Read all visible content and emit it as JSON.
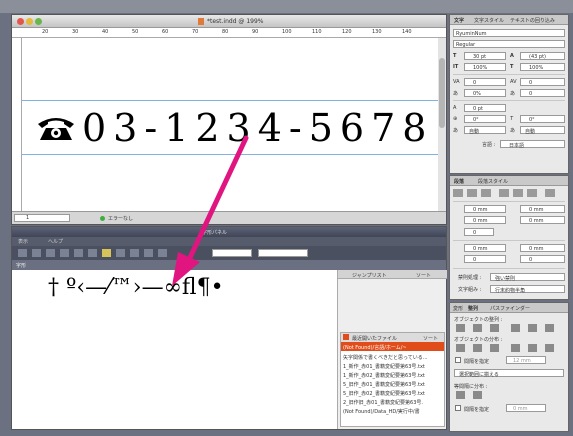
{
  "doc_window": {
    "title": "*test.indd @ 199%",
    "ruler_marks": [
      "20",
      "30",
      "40",
      "50",
      "60",
      "70",
      "80",
      "90",
      "100",
      "110",
      "120",
      "130",
      "140"
    ],
    "phone_number": "03-1234-5678",
    "status_page": "1",
    "status_text": "エラーなし"
  },
  "glyph_window": {
    "title": "字形パネル",
    "tab_label": "字形",
    "menu_items": [
      "表示",
      "ヘルプ"
    ],
    "glyph_row": "† º‹—⁄™›—∞ﬂ¶•",
    "panel_tabs": [
      "ジャンプリスト",
      "ソート"
    ],
    "recent_title": "最近開いたファイル",
    "recent_tab": "ソート",
    "recent_items": [
      "(Not Found)/言語/ホーム/~",
      "矢字関係で書くべきだと思っている...",
      "1_新作_赤01_書籍変紀要第63号.txt",
      "1_新作_赤02_書籍変紀要第63号.txt",
      "5_旧作_赤01_書籍変紀要第63号.txt",
      "5_旧作_赤02_書籍変紀要第63号.txt",
      "2_旧作旧_赤01_書籍変紀要第63号.",
      "(Not Found)/Data_HD/実行中/書"
    ]
  },
  "char_panel": {
    "tabs": [
      "文字",
      "文字スタイル",
      "テキストの回り込み"
    ],
    "font_family": "RyuminNum",
    "font_style": "Regular",
    "size": "30 pt",
    "leading": "(43 pt)",
    "vscale": "100%",
    "hscale": "100%",
    "kerning": "0",
    "tracking": "0",
    "tsume": "0%",
    "aki": "0",
    "baseline": "0 pt",
    "rotate": "0°",
    "skew": "0°",
    "auto_left": "自動",
    "auto_right": "自動",
    "language_label": "言語 :",
    "language": "日本語"
  },
  "para_panel": {
    "tabs": [
      "段落",
      "段落スタイル"
    ],
    "indent_left": "0 mm",
    "indent_right": "0 mm",
    "first_line": "0 mm",
    "last_line": "0 mm",
    "space_before": "0 mm",
    "space_after": "0 mm",
    "drop_lines": "0",
    "drop_chars": "0",
    "kinsoku_label": "禁則処理 :",
    "kinsoku_value": "強い禁則",
    "mojikumi_label": "文字組み :",
    "mojikumi_value": "行末約物半角",
    "hyph_value": "0"
  },
  "align_panel": {
    "tabs": [
      "変形",
      "整列",
      "パスファインダー"
    ],
    "section1": "オブジェクトの整列 :",
    "section2": "オブジェクトの分布 :",
    "spacing_label": "間隔を指定",
    "spacing_value": "12 mm",
    "align_to": "選択範囲に揃える",
    "section3": "等間隔に分布 :",
    "spacing_label2": "間隔を指定",
    "spacing_value2": "0 mm"
  },
  "colors": {
    "arrow": "#e0157f",
    "highlight": "#e04d1a",
    "selection": "#7fb3e0"
  },
  "icons": [
    "phone-icon",
    "arrow-icon",
    "close-dot",
    "minimize-dot",
    "zoom-dot"
  ]
}
